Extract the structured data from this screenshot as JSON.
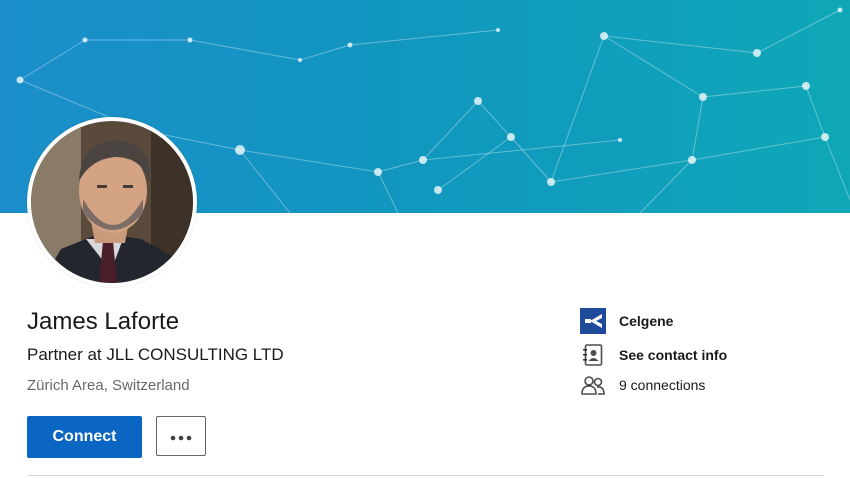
{
  "profile": {
    "name": "James Laforte",
    "headline": "Partner at JLL CONSULTING LTD",
    "location": "Zürich Area, Switzerland"
  },
  "actions": {
    "connect_label": "Connect"
  },
  "sidebar": {
    "company": "Celgene",
    "contact_label": "See contact info",
    "connections": "9 connections"
  },
  "colors": {
    "accent": "#0a66c2",
    "banner_start": "#1b8ec9",
    "banner_end": "#0fa7b8"
  },
  "icons": [
    "company-logo",
    "contact-card-icon",
    "people-icon",
    "more-icon"
  ]
}
